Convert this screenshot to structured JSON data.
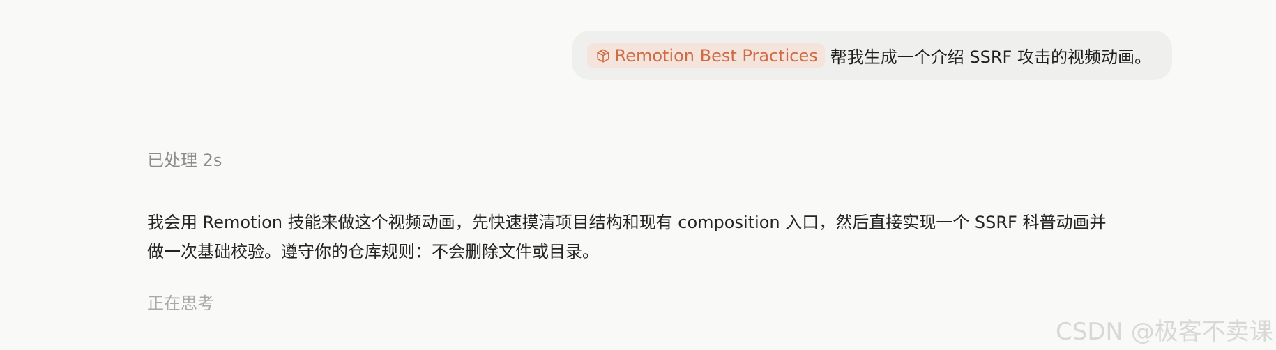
{
  "user_message": {
    "skill_chip_label": "Remotion Best Practices",
    "skill_chip_icon": "cube-icon",
    "text": "帮我生成一个介绍 SSRF 攻击的视频动画。"
  },
  "assistant": {
    "status": "已处理 2s",
    "response_line1": "我会用 Remotion 技能来做这个视频动画，先快速摸清项目结构和现有 composition 入口，然后直接实现一个 SSRF 科普动画并",
    "response_line2": "做一次基础校验。遵守你的仓库规则：不会删除文件或目录。",
    "thinking": "正在思考"
  },
  "watermark": "CSDN @极客不卖课",
  "colors": {
    "chip_text": "#cf6c47",
    "chip_bg": "#f4e4dc",
    "bubble_bg": "#efefed",
    "page_bg": "#f9f9f8"
  }
}
